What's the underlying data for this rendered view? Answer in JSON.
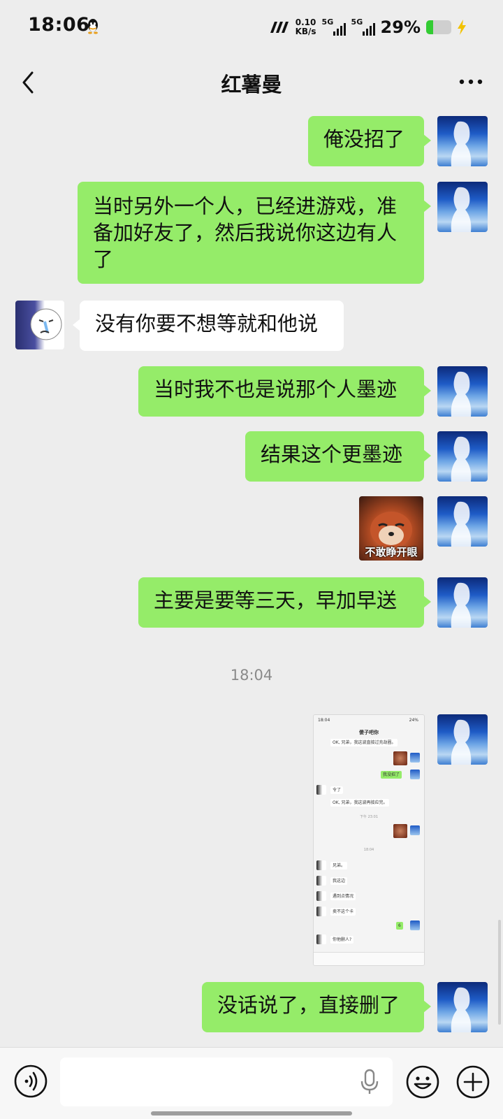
{
  "status_bar": {
    "time": "18:06",
    "net_speed_value": "0.10",
    "net_speed_unit": "KB/s",
    "sim1_label": "5G",
    "sim2_label": "5G",
    "battery_percent": "29%",
    "battery_level": 0.29,
    "icons": [
      "qq-icon",
      "network-icon",
      "signal-icon",
      "battery-icon",
      "charging-icon"
    ]
  },
  "nav": {
    "title": "红薯曼",
    "back_icon": "chevron-left-icon",
    "more_icon": "more-dots-icon"
  },
  "messages": [
    {
      "from": "me",
      "type": "text",
      "text": "俺没招了"
    },
    {
      "from": "me",
      "type": "text",
      "text": "当时另外一个人，已经进游戏，准备加好友了，然后我说你这边有人了"
    },
    {
      "from": "other",
      "type": "text",
      "text": "没有你要不想等就和他说"
    },
    {
      "from": "me",
      "type": "text",
      "text": "当时我不也是说那个人墨迹"
    },
    {
      "from": "me",
      "type": "text",
      "text": "结果这个更墨迹"
    },
    {
      "from": "me",
      "type": "sticker",
      "caption": "不敢睁开眼"
    },
    {
      "from": "me",
      "type": "text",
      "text": "主要是要等三天，早加早送"
    },
    {
      "from": "system",
      "type": "time",
      "text": "18:04"
    },
    {
      "from": "me",
      "type": "image",
      "description": "screenshot"
    },
    {
      "from": "me",
      "type": "text",
      "text": "没话说了，直接删了"
    }
  ],
  "embedded_screenshot": {
    "time": "18:04",
    "battery": "24%",
    "title": "傻子吧你",
    "lines": [
      "OK, 兄弟，我这波直接过充劫圈。",
      "我没招了",
      "令了",
      "OK, 兄弟，我这波再接应完。",
      "下午 23:01",
      "18:04",
      "兄弟。",
      "我这边",
      "遇到点情况",
      "卖不这个卡",
      "6",
      "你他删人?"
    ]
  },
  "input_bar": {
    "placeholder": "",
    "icons": [
      "voice-icon",
      "mic-icon",
      "emoji-icon",
      "plus-icon"
    ]
  }
}
